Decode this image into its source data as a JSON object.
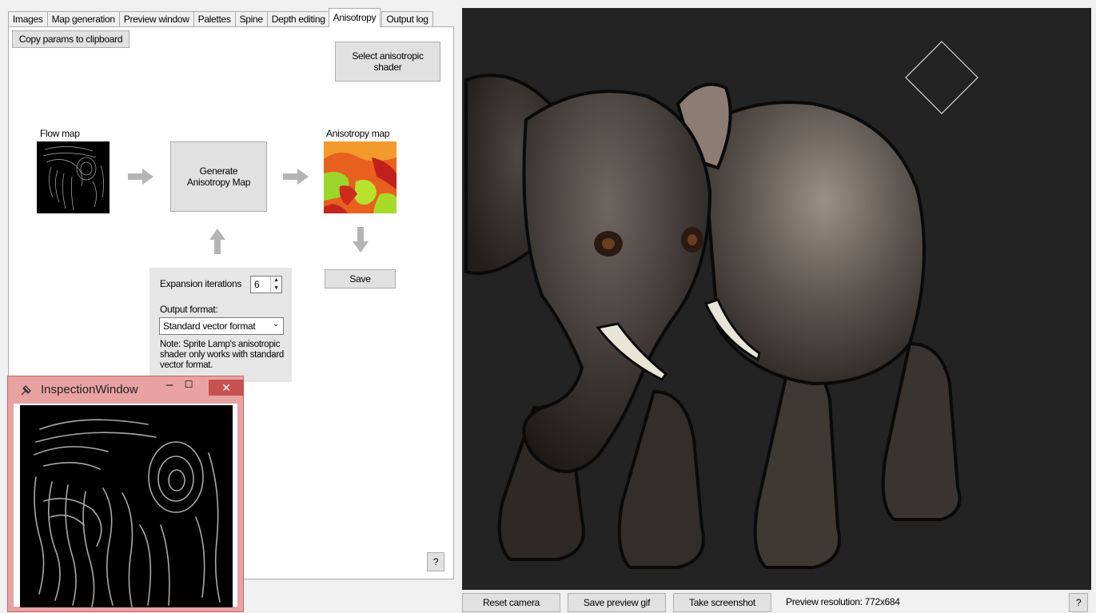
{
  "tabs": [
    {
      "label": "Images"
    },
    {
      "label": "Map generation"
    },
    {
      "label": "Preview window"
    },
    {
      "label": "Palettes"
    },
    {
      "label": "Spine"
    },
    {
      "label": "Depth editing"
    },
    {
      "label": "Anisotropy",
      "active": true
    },
    {
      "label": "Output log"
    }
  ],
  "anisotropy": {
    "copy_params_label": "Copy params to clipboard",
    "select_shader_label": "Select anisotropic shader",
    "flow_map_caption": "Flow map",
    "generate_label": "Generate Anisotropy Map",
    "anisotropy_map_caption": "Anisotropy map",
    "save_label": "Save",
    "expansion_label": "Expansion iterations",
    "expansion_value": "6",
    "output_format_label": "Output format:",
    "output_format_value": "Standard vector format",
    "note": "Note: Sprite Lamp's anisotropic shader only works with standard vector format.",
    "help_label": "?"
  },
  "preview": {
    "reset_camera_label": "Reset camera",
    "save_gif_label": "Save preview gif",
    "screenshot_label": "Take screenshot",
    "resolution_text": "Preview resolution: 772x684",
    "help_label": "?"
  },
  "inspection_window": {
    "title": "InspectionWindow",
    "minimize": "–",
    "maximize": "☐",
    "close": "✕"
  },
  "icons": {
    "arrow": "arrow-icon",
    "pin": "pin-icon",
    "gizmo": "light-gizmo-icon"
  },
  "colors": {
    "viewport_bg": "#232323",
    "inspection_frame": "#e8a2a2",
    "close_button": "#c75050"
  }
}
